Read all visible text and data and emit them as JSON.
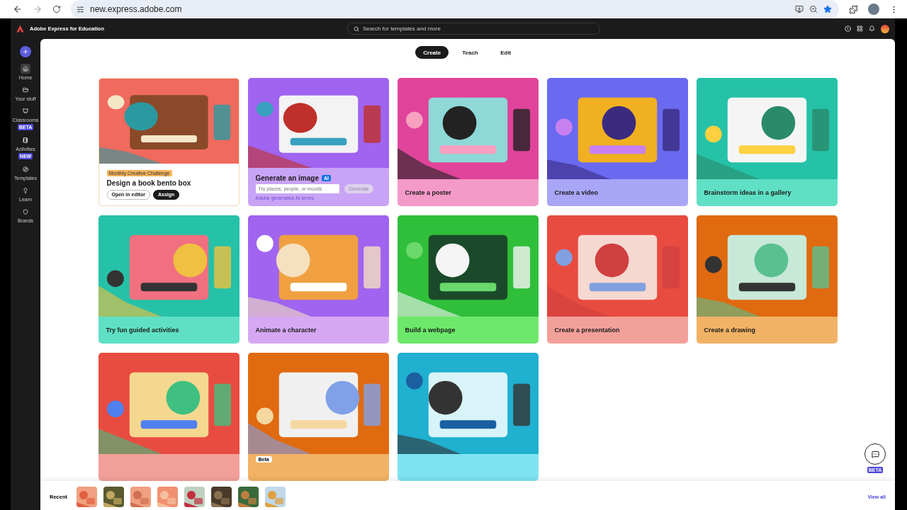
{
  "browser": {
    "url": "new.express.adobe.com"
  },
  "app": {
    "title": "Adobe Express for Education",
    "search": {
      "placeholder": "Search for templates and more"
    }
  },
  "sidebar": {
    "items": [
      {
        "label": "Home",
        "selected": true,
        "kind": "home"
      },
      {
        "label": "Your stuff",
        "selected": false,
        "kind": "folder"
      },
      {
        "label": "Classrooms",
        "selected": false,
        "kind": "classroom",
        "badge": "BETA"
      },
      {
        "label": "Activities",
        "selected": false,
        "kind": "activity",
        "badge": "NEW"
      },
      {
        "label": "Templates",
        "selected": false,
        "kind": "templates"
      },
      {
        "label": "Learn",
        "selected": false,
        "kind": "learn"
      },
      {
        "label": "Brands",
        "selected": false,
        "kind": "brands"
      }
    ]
  },
  "tabs": [
    {
      "label": "Create",
      "selected": true
    },
    {
      "label": "Teach",
      "selected": false
    },
    {
      "label": "Edit",
      "selected": false
    }
  ],
  "cards": [
    {
      "kind": "challenge",
      "color": "#f06a5e",
      "tag": "Monthly Creative Challenge",
      "title": "Design a book bento box",
      "buttons": [
        "Open in editor",
        "Assign"
      ]
    },
    {
      "kind": "generate",
      "color": "#c9a3f5",
      "title": "Generate an image",
      "badge": "AI",
      "placeholder": "Try places, people, or moods",
      "button": "Generate",
      "link": "Adobe generative AI terms"
    },
    {
      "kind": "plain",
      "color": "#f49ac8",
      "title": "Create a poster"
    },
    {
      "kind": "plain",
      "color": "#a9a6f7",
      "title": "Create a video"
    },
    {
      "kind": "plain",
      "color": "#5fe0c4",
      "title": "Brainstorm ideas in a gallery"
    },
    {
      "kind": "plain",
      "color": "#5fe0c4",
      "title": "Try fun guided activities"
    },
    {
      "kind": "plain",
      "color": "#d6a8f4",
      "title": "Animate a character"
    },
    {
      "kind": "plain",
      "color": "#6de86a",
      "title": "Build a webpage"
    },
    {
      "kind": "plain",
      "color": "#f4a09a",
      "title": "Create a presentation"
    },
    {
      "kind": "plain",
      "color": "#f2b265",
      "title": "Create a drawing"
    },
    {
      "kind": "plain",
      "color": "#f4a09a"
    },
    {
      "kind": "plain",
      "color": "#f2b265",
      "badge": "Beta"
    },
    {
      "kind": "plain",
      "color": "#7ee3f0"
    }
  ],
  "help": {
    "badge": "BETA"
  },
  "recent": {
    "label": "Recent",
    "link": "View all"
  }
}
